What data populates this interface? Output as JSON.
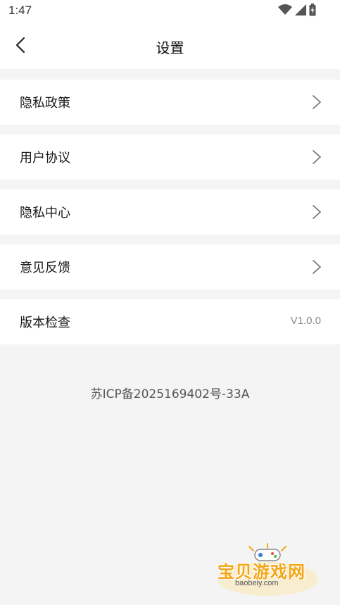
{
  "status_bar": {
    "time": "1:47",
    "icons": [
      "wifi-icon",
      "signal-icon",
      "battery-icon"
    ]
  },
  "header": {
    "title": "设置",
    "back_icon": "chevron-left-icon"
  },
  "settings": {
    "items": [
      {
        "label": "隐私政策",
        "icon": "chevron-right-icon"
      },
      {
        "label": "用户协议",
        "icon": "chevron-right-icon"
      },
      {
        "label": "隐私中心",
        "icon": "chevron-right-icon"
      },
      {
        "label": "意见反馈",
        "icon": "chevron-right-icon"
      },
      {
        "label": "版本检查",
        "value": "V1.0.0"
      }
    ]
  },
  "footer": {
    "icp": "苏ICP备2025169402号-33A"
  },
  "watermark": {
    "name": "宝贝游戏网",
    "url": "baobeiy.com"
  },
  "colors": {
    "background": "#f4f4f4",
    "card": "#ffffff",
    "accent_watermark": "#f3a71a",
    "value_text": "#8a8a8a"
  }
}
